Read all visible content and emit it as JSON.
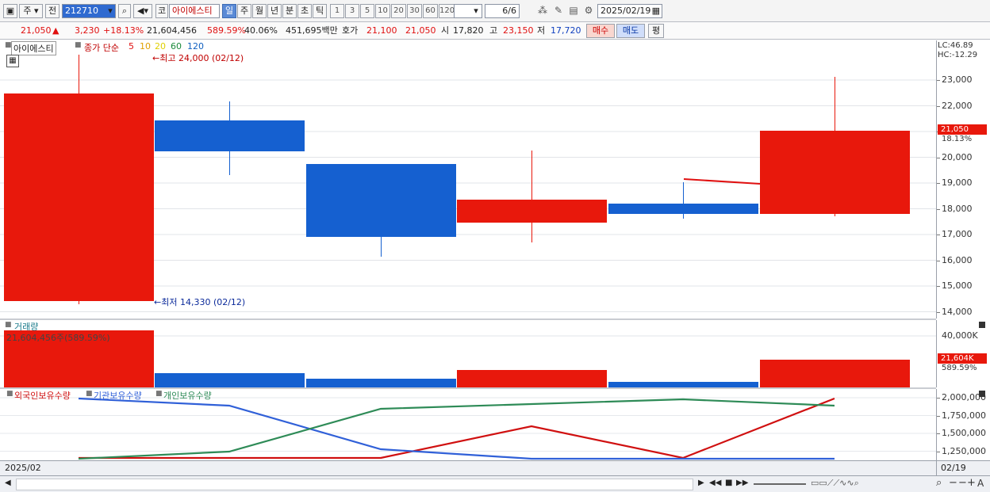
{
  "toolbar": {
    "market_label": "주",
    "prev_label": "전",
    "code_value": "212710",
    "stock_name_prefix": "코",
    "stock_name": "아이에스티",
    "periods": [
      "일",
      "주",
      "월",
      "년",
      "분",
      "초",
      "틱"
    ],
    "active_period": "일",
    "minute_options": [
      "1",
      "3",
      "5",
      "10",
      "20",
      "30",
      "60",
      "120"
    ],
    "page_indicator": "6/6",
    "date_value": "2025/02/19"
  },
  "quote": {
    "price": "21,050",
    "change": "3,230",
    "change_pct": "+18.13%",
    "volume": "21,604,456",
    "volume_ratio": "589.59%",
    "turnover": "40.06%",
    "amount": "451,695백만",
    "bid_label": "호가",
    "bid": "21,100",
    "ask": "21,050",
    "open_label": "시",
    "open": "17,820",
    "high_label": "고",
    "high": "23,150",
    "low_label": "저",
    "low": "17,720",
    "buy_label": "매수",
    "sell_label": "매도",
    "eval_label": "평"
  },
  "price_panel": {
    "stock_label": "아이에스티",
    "ma_label": "종가 단순",
    "ma_periods": [
      "5",
      "10",
      "20",
      "60",
      "120"
    ],
    "ma_colors": [
      "#e01010",
      "#e0a000",
      "#e0d000",
      "#1a8a3a",
      "#1060c0"
    ],
    "high_note": "최고 24,000 (02/12)",
    "low_note": "최저 14,330 (02/12)",
    "lc": "LC:46.89",
    "hc": "HC:-12.29",
    "price_tag": "21,050",
    "pct_tag": "18.13%",
    "y_labels": [
      "23,000",
      "22,000",
      "21,000",
      "20,000",
      "19,000",
      "18,000",
      "17,000",
      "16,000",
      "15,000",
      "14,000"
    ]
  },
  "volume_panel": {
    "title": "거래량",
    "value_note": "21,604,456주(589.59%)",
    "y_label": "40,000K",
    "tag": "21,604K",
    "tag_pct": "589.59%"
  },
  "holdings_panel": {
    "series_labels": [
      "외국인보유수량",
      "기관보유수량",
      "개인보유수량"
    ],
    "series_colors": [
      "#d01010",
      "#3060d8",
      "#2e8b57"
    ],
    "y_labels": [
      "2,000,000",
      "1,750,000",
      "1,500,000",
      "1,250,000"
    ]
  },
  "x_axis": {
    "start_label": "2025/02",
    "end_label": "02/19"
  },
  "colors": {
    "up": "#e8180c",
    "down": "#1560d0"
  }
}
